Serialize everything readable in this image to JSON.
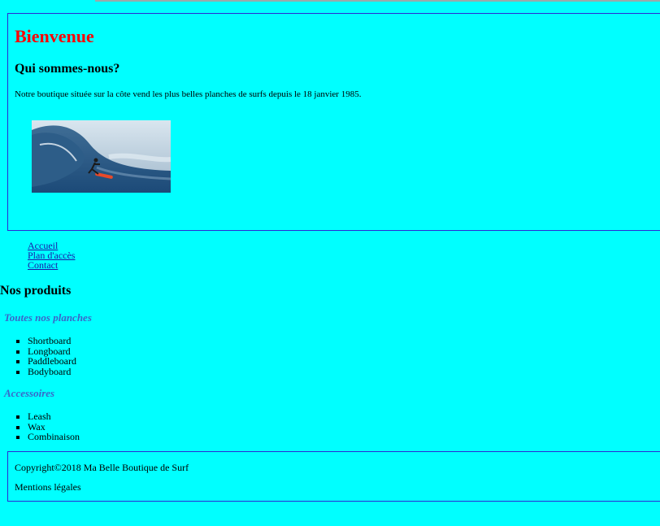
{
  "header": {
    "title": "Bienvenue",
    "subtitle": "Qui sommes-nous?",
    "intro": "Notre boutique située sur la côte vend les plus belles planches de surfs depuis le 18 janvier 1985."
  },
  "nav": {
    "items": [
      "Accueil",
      "Plan d'accès",
      "Contact"
    ]
  },
  "products": {
    "title": "Nos produits",
    "boards_title": "Toutes nos planches",
    "boards": [
      "Shortboard",
      "Longboard",
      "Paddleboard",
      "Bodyboard"
    ],
    "accessories_title": "Accessoires",
    "accessories": [
      "Leash",
      "Wax",
      "Combinaison"
    ]
  },
  "footer": {
    "copyright": "Copyright©2018 Ma Belle Boutique de Surf",
    "legal": "Mentions légales"
  },
  "colors": {
    "background": "#00ffff",
    "title": "#ff0000",
    "border": "#2b2bd6",
    "category": "#3a66c9",
    "link": "#1a1aa8"
  }
}
